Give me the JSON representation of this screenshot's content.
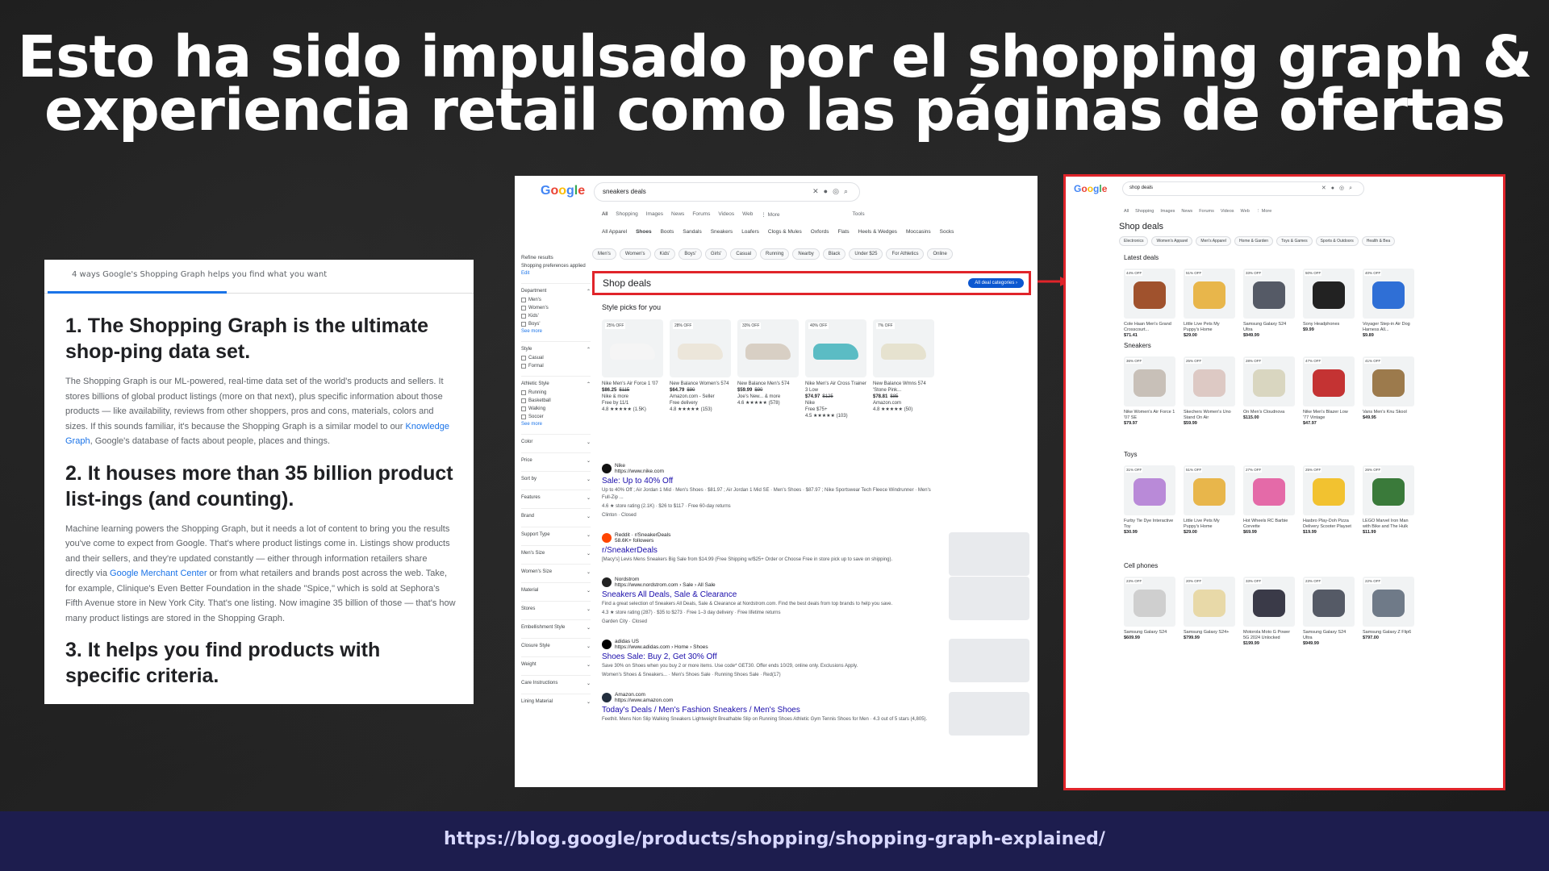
{
  "slide": {
    "title_line1": "Esto ha sido impulsado por el shopping graph &",
    "title_line2": "experiencia retail como las páginas de ofertas",
    "footer_url": "https://blog.google/products/shopping/shopping-graph-explained/"
  },
  "article": {
    "tab_label": "4 ways Google's Shopping Graph helps you find what you want",
    "h1": "1. The Shopping Graph is the ultimate shop-ping data set.",
    "p1_a": "The Shopping Graph is our ML-powered, real-time data set of the world's products and sellers. It stores billions of global product listings (more on that next), plus specific information about those products — like availability, reviews from other shoppers, pros and cons, materials, colors and sizes. If this sounds familiar, it's because the Shopping Graph is a similar model to our ",
    "p1_link": "Knowledge Graph",
    "p1_b": ", Google's database of facts about people, places and things.",
    "h2": "2. It houses more than 35 billion product list-ings (and counting).",
    "p2_a": "Machine learning powers the Shopping Graph, but it needs a lot of content to bring you the results you've come to expect from Google. That's where product listings come in. Listings show products and their sellers, and they're updated constantly — either through information retailers share directly via ",
    "p2_link": "Google Merchant Center",
    "p2_b": " or from what retailers and brands post across the web. Take, for example, Clinique's Even Better Foundation in the shade \"Spice,\" which is sold at Sephora's Fifth Avenue store in New York City. That's one listing. Now imagine 35 billion of those — that's how many product listings are stored in the Shopping Graph.",
    "h3": "3. It helps you find products with specific criteria."
  },
  "serp": {
    "logo": [
      "G",
      "o",
      "o",
      "g",
      "l",
      "e"
    ],
    "query": "sneakers deals",
    "nav": [
      "All",
      "Shopping",
      "Images",
      "News",
      "Forums",
      "Videos",
      "Web",
      "⋮ More"
    ],
    "tools": "Tools",
    "categories": [
      "All Apparel",
      "Shoes",
      "Boots",
      "Sandals",
      "Sneakers",
      "Loafers",
      "Clogs & Mules",
      "Oxfords",
      "Flats",
      "Heels & Wedges",
      "Moccasins",
      "Socks"
    ],
    "chips": [
      "Men's",
      "Women's",
      "Kids'",
      "Boys'",
      "Girls'",
      "Casual",
      "Running",
      "Nearby",
      "Black",
      "Under $25",
      "For Athletics",
      "Online"
    ],
    "refine": {
      "title": "Refine results",
      "pref": "Shopping preferences applied",
      "edit": "Edit",
      "department": "Department",
      "dept_items": [
        "Men's",
        "Women's",
        "Kids'",
        "Boys'"
      ],
      "see_more": "See more",
      "style": "Style",
      "style_items": [
        "Casual",
        "Formal"
      ],
      "athletic": "Athletic Style",
      "athletic_items": [
        "Running",
        "Basketball",
        "Walking",
        "Soccer"
      ],
      "filters": [
        "Color",
        "Price",
        "Sort by",
        "Features",
        "Brand",
        "Support Type",
        "Men's Size",
        "Women's Size",
        "Material",
        "Stores",
        "Embellishment Style",
        "Closure Style",
        "Weight",
        "Care Instructions",
        "Lining Material"
      ]
    },
    "deals_title": "Shop deals",
    "deals_button": "All deal categories ›",
    "style_picks": "Style picks for you",
    "products": [
      {
        "badge": "25% OFF",
        "name": "Nike Men's Air Force 1 '07",
        "price": "$86.25",
        "was": "$115",
        "store": "Nike & more",
        "ship": "Free by 11/1",
        "rating": "4.8 ★★★★★ (1.5K)",
        "color": "#f5f5f5"
      },
      {
        "badge": "28% OFF",
        "name": "New Balance Women's 574",
        "price": "$64.79",
        "was": "$90",
        "store": "Amazon.com - Seller",
        "ship": "Free delivery",
        "rating": "4.8 ★★★★★ (153)",
        "color": "#ece6da"
      },
      {
        "badge": "33% OFF",
        "name": "New Balance Men's 574",
        "price": "$59.99",
        "was": "$90",
        "store": "Joe's New... & more",
        "ship": "",
        "rating": "4.6 ★★★★★ (578)",
        "color": "#d8cfc4"
      },
      {
        "badge": "40% OFF",
        "name": "Nike Men's Air Cross Trainer 3 Low",
        "price": "$74.97",
        "was": "$125",
        "store": "Nike",
        "ship": "Free $75+",
        "rating": "4.5 ★★★★★ (103)",
        "color": "#5bbcc4"
      },
      {
        "badge": "7% OFF",
        "name": "New Balance Wmns 574 'Stone Pink...",
        "price": "$78.81",
        "was": "$85",
        "store": "Amazon.com",
        "ship": "",
        "rating": "4.8 ★★★★★ (50)",
        "color": "#e6e2cf"
      }
    ],
    "results": [
      {
        "site": "Nike",
        "url": "https://www.nike.com",
        "title": "Sale: Up to 40% Off",
        "snippet": "Up to 40% Off ; Air Jordan 1 Mid · Men's Shoes · $81.97 ; Air Jordan 1 Mid SE · Men's Shoes · $87.97 ; Nike Sportswear Tech Fleece Windrunner · Men's Full-Zip ...",
        "extra": "4.6 ★ store rating (2.1K) · $26 to $117 · Free 60-day returns",
        "loc": "Clinton · Closed",
        "fav": "#111"
      },
      {
        "site": "Reddit · r/SneakerDeals",
        "url": "58.6K+ followers",
        "title": "r/SneakerDeals",
        "snippet": "[Macy's] Levis Mens Sneakers Big Sale from $14.99 (Free Shipping w/$25+ Order or Choose Free in store pick up to save on shipping).",
        "extra": "",
        "loc": "",
        "fav": "#ff4500"
      },
      {
        "site": "Nordstrom",
        "url": "https://www.nordstrom.com › Sale › All Sale",
        "title": "Sneakers All Deals, Sale & Clearance",
        "snippet": "Find a great selection of Sneakers All Deals, Sale & Clearance at Nordstrom.com. Find the best deals from top brands to help you save.",
        "extra": "4.3 ★ store rating (287) · $35 to $273 · Free 1–3 day delivery · Free lifetime returns",
        "loc": "Garden City · Closed",
        "fav": "#222"
      },
      {
        "site": "adidas US",
        "url": "https://www.adidas.com › Home › Shoes",
        "title": "Shoes Sale: Buy 2, Get 30% Off",
        "snippet": "Save 30% on Shoes when you buy 2 or more items. Use code* GET30. Offer ends 10/29, online only. Exclusions Apply.",
        "extra": "Women's Shoes & Sneakers... · Men's Shoes Sale · Running Shoes Sale · Red(17)",
        "loc": "",
        "fav": "#000"
      },
      {
        "site": "Amazon.com",
        "url": "https://www.amazon.com",
        "title": "Today's Deals / Men's Fashion Sneakers / Men's Shoes",
        "snippet": "Feethit. Mens Non Slip Walking Sneakers Lightweight Breathable Slip on Running Shoes Athletic Gym Tennis Shoes for Men · 4.3 out of 5 stars (4,805).",
        "extra": "",
        "loc": "",
        "fav": "#232f3e"
      }
    ]
  },
  "shop": {
    "query": "shop deals",
    "nav": [
      "All",
      "Shopping",
      "Images",
      "News",
      "Forums",
      "Videos",
      "Web",
      "⋮ More"
    ],
    "title": "Shop deals",
    "chips": [
      "Electronics",
      "Women's Apparel",
      "Men's Apparel",
      "Home & Garden",
      "Toys & Games",
      "Sports & Outdoors",
      "Health & Bea"
    ],
    "sections": [
      {
        "name": "Latest deals",
        "items": [
          {
            "badge": "44% OFF",
            "name": "Cole Haan Men's Grand Crosscourt...",
            "price": "$71.41",
            "color": "#a0522d"
          },
          {
            "badge": "51% OFF",
            "name": "Little Live Pets My Puppy's Home",
            "price": "$29.00",
            "color": "#e8b64b"
          },
          {
            "badge": "33% OFF",
            "name": "Samsung Galaxy S24 Ultra",
            "price": "$949.99",
            "color": "#555a66"
          },
          {
            "badge": "50% OFF",
            "name": "Sony Headphones",
            "price": "$9.99",
            "color": "#222222"
          },
          {
            "badge": "40% OFF",
            "name": "Voyager Step-in Air Dog Harness All...",
            "price": "$9.89",
            "color": "#2f6fd6"
          }
        ]
      },
      {
        "name": "Sneakers",
        "items": [
          {
            "badge": "36% OFF",
            "name": "Nike Women's Air Force 1 '07 SE",
            "price": "$79.97",
            "color": "#c8c0b8"
          },
          {
            "badge": "25% OFF",
            "name": "Skechers Women's Uno Stand On Air",
            "price": "$59.99",
            "color": "#ddc9c4"
          },
          {
            "badge": "28% OFF",
            "name": "On Men's Cloudnova",
            "price": "$115.00",
            "color": "#d9d6c0"
          },
          {
            "badge": "47% OFF",
            "name": "Nike Men's Blazer Low '77 Vintage",
            "price": "$47.97",
            "color": "#c43333"
          },
          {
            "badge": "41% OFF",
            "name": "Vans Men's Knu Skool",
            "price": "$49.95",
            "color": "#9c7a4c"
          }
        ]
      },
      {
        "name": "Toys",
        "items": [
          {
            "badge": "31% OFF",
            "name": "Furby Tie Dye Interactive Toy",
            "price": "$30.99",
            "color": "#b98ad8"
          },
          {
            "badge": "51% OFF",
            "name": "Little Live Pets My Puppy's Home",
            "price": "$29.00",
            "color": "#e8b64b"
          },
          {
            "badge": "27% OFF",
            "name": "Hot Wheels RC Barbie Corvette",
            "price": "$69.99",
            "color": "#e46aa8"
          },
          {
            "badge": "25% OFF",
            "name": "Hasbro Play-Doh Pizza Delivery Scooter Playset",
            "price": "$19.99",
            "color": "#f2c230"
          },
          {
            "badge": "26% OFF",
            "name": "LEGO Marvel Iron Man with Bike and The Hulk",
            "price": "$11.99",
            "color": "#3a7a3a"
          }
        ]
      },
      {
        "name": "Cell phones",
        "items": [
          {
            "badge": "23% OFF",
            "name": "Samsung Galaxy S24",
            "price": "$609.99",
            "color": "#cfcfcf"
          },
          {
            "badge": "20% OFF",
            "name": "Samsung Galaxy S24+",
            "price": "$799.99",
            "color": "#e8d9a8"
          },
          {
            "badge": "33% OFF",
            "name": "Motorola Moto G Power 5G 2024 Unlocked",
            "price": "$199.99",
            "color": "#3a3a48"
          },
          {
            "badge": "23% OFF",
            "name": "Samsung Galaxy S24 Ultra",
            "price": "$949.99",
            "color": "#555a66"
          },
          {
            "badge": "22% OFF",
            "name": "Samsung Galaxy Z Flip6",
            "price": "$797.00",
            "color": "#6f7a88"
          }
        ]
      }
    ]
  }
}
